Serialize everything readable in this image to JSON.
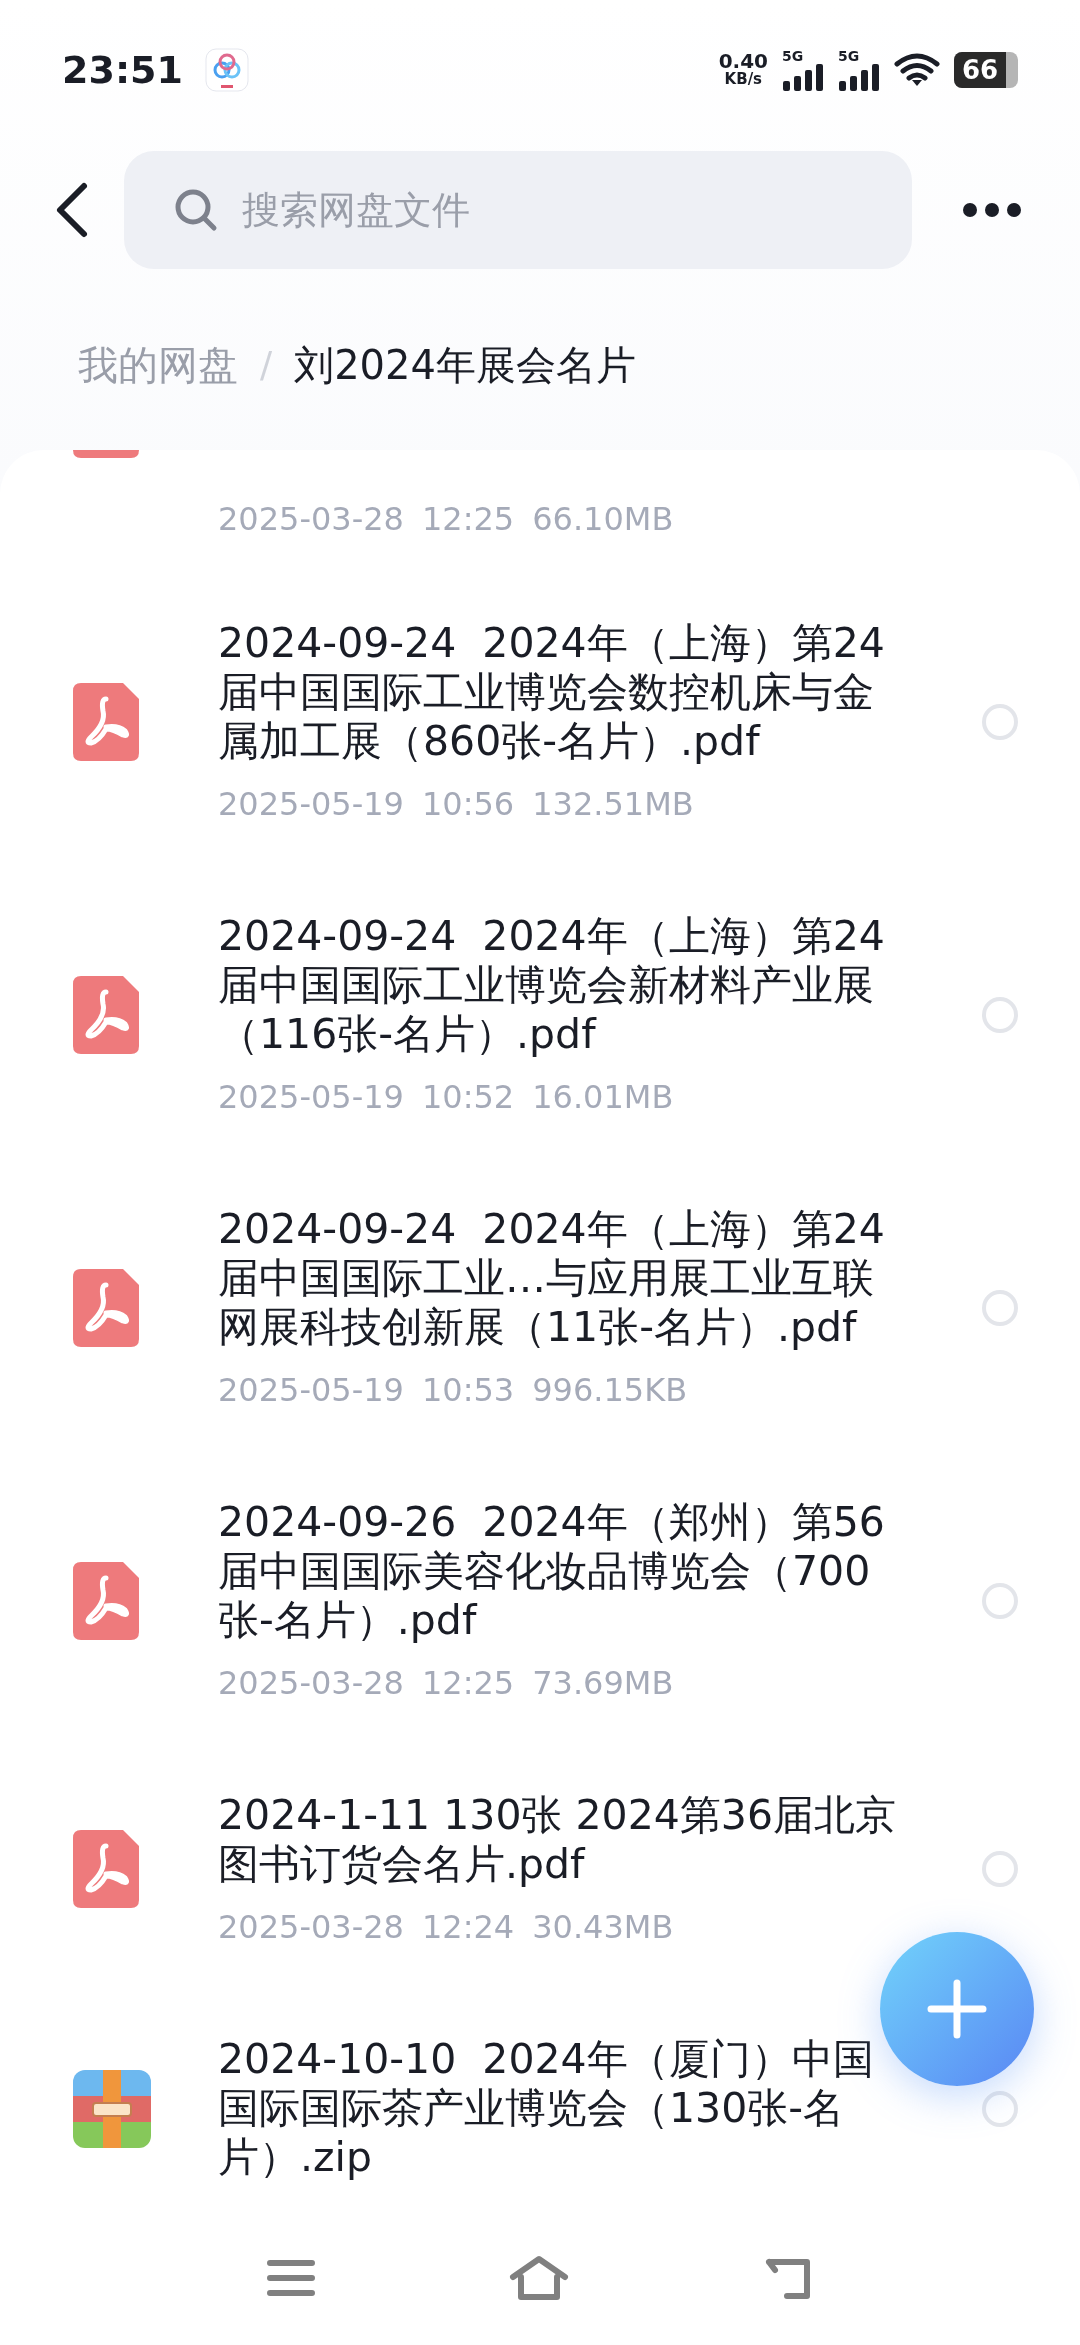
{
  "status_bar": {
    "time": "23:51",
    "net_speed": "0.40",
    "net_unit": "KB/s",
    "signal_1": "5G",
    "signal_2": "5G",
    "battery": "66"
  },
  "search": {
    "placeholder": "搜索网盘文件"
  },
  "breadcrumb": [
    {
      "label": "我的网盘",
      "current": false
    },
    {
      "separator": "/"
    },
    {
      "label": "刘2024年展会名片",
      "current": true
    }
  ],
  "partial_row": {
    "kind": "pdf",
    "meta": [
      "2025-03-28",
      "12:25",
      "66.10MB"
    ]
  },
  "files": [
    {
      "kind": "pdf",
      "name": "2024-09-24  2024年（上海）第24届中国国际工业博览会数控机床与金属加工展（860张-名片）.pdf",
      "meta": [
        "2025-05-19",
        "10:56",
        "132.51MB"
      ],
      "selected": false
    },
    {
      "kind": "pdf",
      "name": "2024-09-24  2024年（上海）第24届中国国际工业博览会新材料产业展（116张-名片）.pdf",
      "meta": [
        "2025-05-19",
        "10:52",
        "16.01MB"
      ],
      "selected": false
    },
    {
      "kind": "pdf",
      "name": "2024-09-24  2024年（上海）第24届中国国际工业…与应用展工业互联网展科技创新展（11张-名片）.pdf",
      "meta": [
        "2025-05-19",
        "10:53",
        "996.15KB"
      ],
      "selected": false
    },
    {
      "kind": "pdf",
      "name": "2024-09-26  2024年（郑州）第56届中国国际美容化妆品博览会（700张-名片）.pdf",
      "meta": [
        "2025-03-28",
        "12:25",
        "73.69MB"
      ],
      "selected": false
    },
    {
      "kind": "pdf",
      "name": "2024-1-11 130张 2024第36届北京图书订货会名片.pdf",
      "meta": [
        "2025-03-28",
        "12:24",
        "30.43MB"
      ],
      "selected": false
    },
    {
      "kind": "zip",
      "name": "2024-10-10  2024年（厦门）中国国际国际茶产业博览会（130张-名片）.zip",
      "selected": false
    }
  ]
}
